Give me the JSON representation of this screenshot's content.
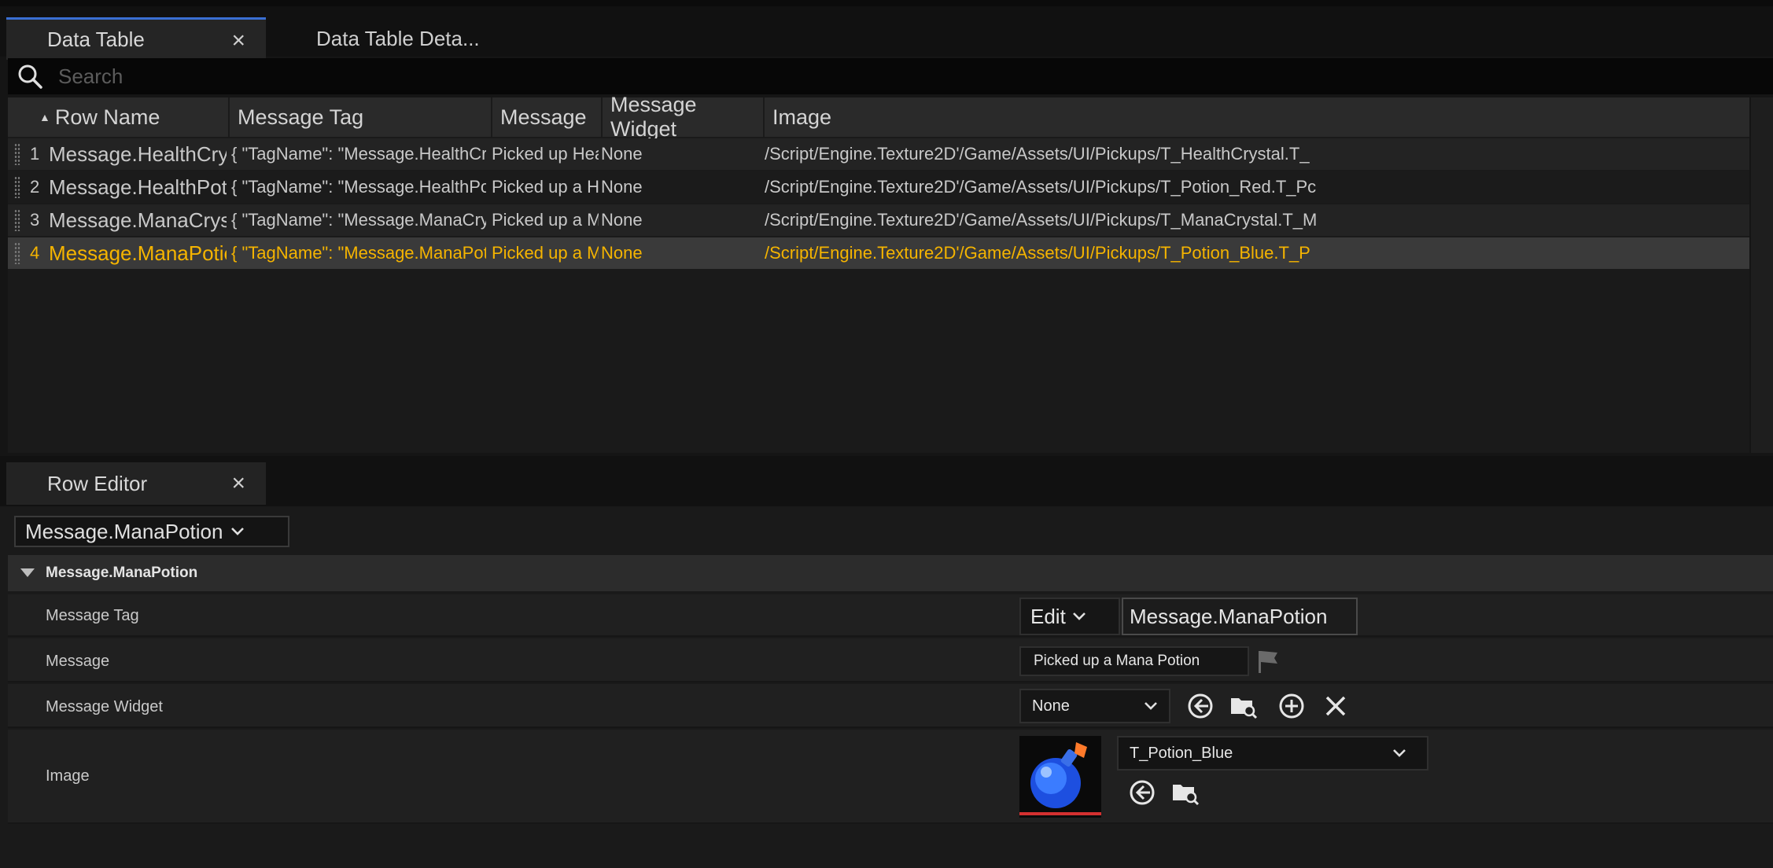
{
  "tabs": {
    "data_table": "Data Table",
    "details": "Data Table Deta...",
    "close": "×"
  },
  "search": {
    "placeholder": "Search"
  },
  "table": {
    "columns": [
      "Row Name",
      "Message Tag",
      "Message",
      "Message Widget",
      "Image"
    ],
    "rows": [
      {
        "index": "1",
        "row_name": "Message.HealthCrystal",
        "tag": "{ \"TagName\": \"Message.HealthCrystal\" }",
        "message": "Picked up Healt",
        "widget": "None",
        "image": "/Script/Engine.Texture2D'/Game/Assets/UI/Pickups/T_HealthCrystal.T_"
      },
      {
        "index": "2",
        "row_name": "Message.HealthPotion",
        "tag": "{ \"TagName\": \"Message.HealthPotion\" }",
        "message": "Picked up a Hea",
        "widget": "None",
        "image": "/Script/Engine.Texture2D'/Game/Assets/UI/Pickups/T_Potion_Red.T_Pc"
      },
      {
        "index": "3",
        "row_name": "Message.ManaCrystal",
        "tag": "{ \"TagName\": \"Message.ManaCrystal\" }",
        "message": "Picked up a Mar",
        "widget": "None",
        "image": "/Script/Engine.Texture2D'/Game/Assets/UI/Pickups/T_ManaCrystal.T_M"
      },
      {
        "index": "4",
        "row_name": "Message.ManaPotion",
        "tag": "{ \"TagName\": \"Message.ManaPotion\" }",
        "message": "Picked up a Mar",
        "widget": "None",
        "image": "/Script/Engine.Texture2D'/Game/Assets/UI/Pickups/T_Potion_Blue.T_P"
      }
    ],
    "selected_index": 3
  },
  "row_editor": {
    "tab": "Row Editor",
    "selected_row": "Message.ManaPotion",
    "section": "Message.ManaPotion",
    "props": {
      "message_tag": {
        "label": "Message Tag",
        "edit": "Edit",
        "value": "Message.ManaPotion"
      },
      "message": {
        "label": "Message",
        "value": "Picked up a Mana Potion"
      },
      "message_widget": {
        "label": "Message Widget",
        "value": "None"
      },
      "image": {
        "label": "Image",
        "value": "T_Potion_Blue"
      }
    }
  },
  "colors": {
    "selected_text": "#f5b400",
    "accent_tab": "#3a6fd4",
    "thumbnail_underline": "#d43030"
  }
}
